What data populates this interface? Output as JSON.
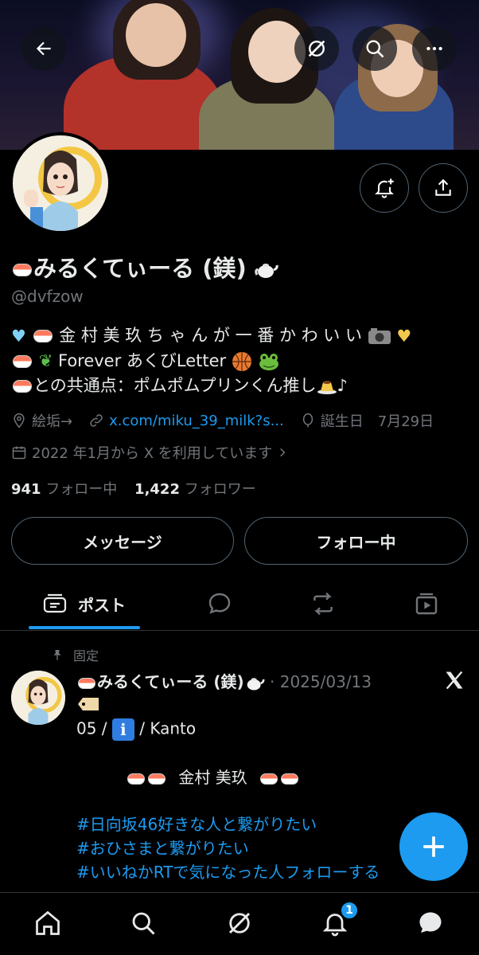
{
  "header": {
    "back_icon": "arrow-left-icon",
    "grok_icon": "grok-icon",
    "search_icon": "search-icon",
    "more_icon": "more-icon"
  },
  "profile": {
    "name": "みるくてぃーる (鎂)",
    "handle": "@dvfzow",
    "bio": [
      "金 村 美 玖 ち ゃ ん が 一 番 か わ い い",
      "Forever あくびLetter",
      "との共通点：ポムポムプリンくん推し",
      "♪"
    ],
    "location": "絵垢→",
    "link": "x.com/miku_39_milk?s...",
    "birthday": "誕生日　7月29日",
    "joined": "2022 年1月から X を利用しています",
    "following_count": "941",
    "following_label": "フォロー中",
    "followers_count": "1,422",
    "followers_label": "フォロワー",
    "message_button": "メッセージ",
    "following_button": "フォロー中"
  },
  "tabs": [
    {
      "label": "ポスト",
      "icon": "posts-icon",
      "active": true
    },
    {
      "label": "",
      "icon": "reply-icon",
      "active": false
    },
    {
      "label": "",
      "icon": "repost-icon",
      "active": false
    },
    {
      "label": "",
      "icon": "media-icon",
      "active": false
    }
  ],
  "post": {
    "pinned_label": "固定",
    "author": "みるくてぃーる (鎂)",
    "date": "· 2025/03/13",
    "line1": "05 /",
    "line1b": "/ Kanto",
    "line2": "金村 美玖",
    "hashtags": [
      "#日向坂46好きな人と繋がりたい",
      "#おひさまと繋がりたい",
      "#いいねかRTで気になった人フォローする"
    ]
  },
  "bottom_nav": {
    "items": [
      "home-icon",
      "search-icon",
      "grok-icon",
      "notifications-icon",
      "messages-icon"
    ],
    "notification_badge": "1"
  },
  "colors": {
    "accent": "#1d9bf0",
    "text_secondary": "#71767b",
    "border": "#536471"
  }
}
